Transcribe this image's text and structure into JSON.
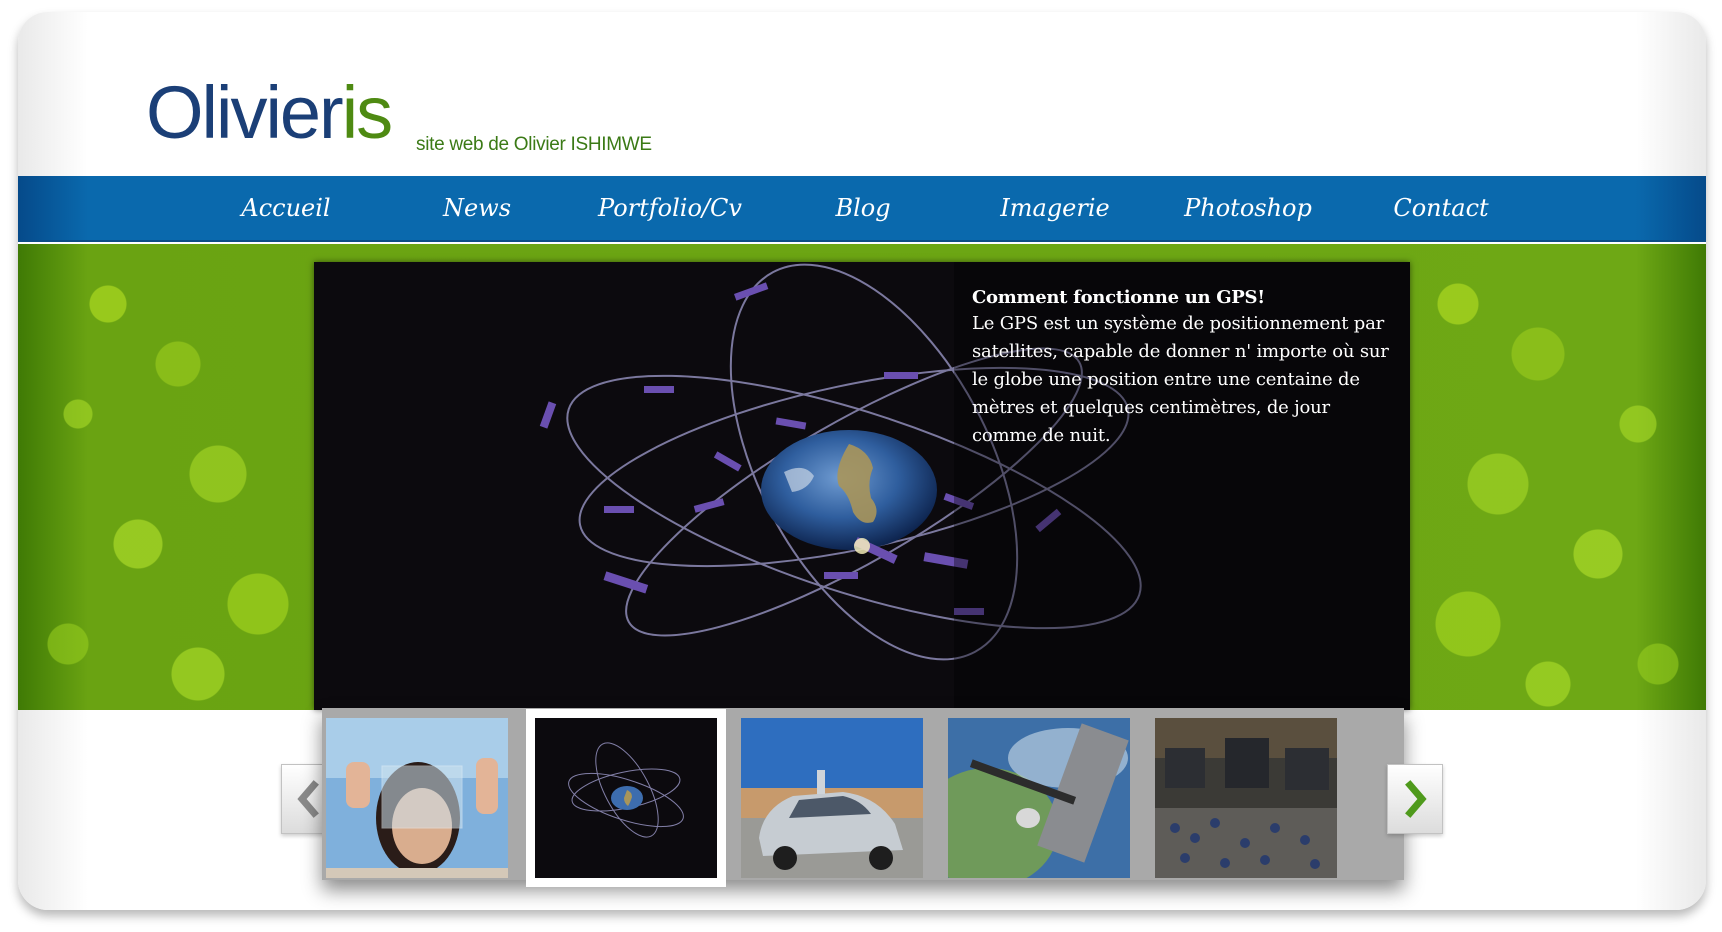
{
  "header": {
    "logo_part1": "Olivier",
    "logo_part2": "is",
    "tagline": "site web de Olivier ISHIMWE"
  },
  "nav": {
    "items": [
      {
        "label": "Accueil"
      },
      {
        "label": "News"
      },
      {
        "label": "Portfolio/Cv"
      },
      {
        "label": "Blog"
      },
      {
        "label": "Imagerie"
      },
      {
        "label": "Photoshop"
      },
      {
        "label": "Contact"
      }
    ]
  },
  "slideshow": {
    "title": "Comment fonctionne un GPS!",
    "text": "Le GPS est un système de positionnement par satellites, capable de donner n' importe où sur le globe une position entre une centaine de mètres et quelques centimètres, de jour comme de nuit.",
    "thumbnails": [
      {
        "icon": "woman-holding-transparent-screen-photo",
        "active": false
      },
      {
        "icon": "gps-satellites-orbit-photo",
        "active": true
      },
      {
        "icon": "google-self-driving-car-photo",
        "active": false
      },
      {
        "icon": "space-station-earth-photo",
        "active": false
      },
      {
        "icon": "stock-exchange-floor-photo",
        "active": false
      }
    ],
    "prev_icon": "chevron-left-icon",
    "next_icon": "chevron-right-icon"
  },
  "colors": {
    "logo_blue": "#1b3f77",
    "logo_green": "#4e8a12",
    "nav_blue": "#0a69ad",
    "banner_green": "#6ea815",
    "arrow_next": "#4f9a1c",
    "arrow_prev": "#8a8a8a"
  }
}
